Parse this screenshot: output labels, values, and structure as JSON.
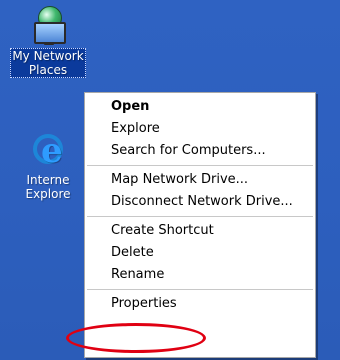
{
  "desktop": {
    "icons": [
      {
        "label_line1": "My Network",
        "label_line2": "Places"
      },
      {
        "label_line1": "Interne",
        "label_line2": "Explore"
      }
    ]
  },
  "context_menu": {
    "items": [
      {
        "label": "Open"
      },
      {
        "label": "Explore"
      },
      {
        "label": "Search for Computers..."
      },
      {
        "label": "Map Network Drive..."
      },
      {
        "label": "Disconnect Network Drive..."
      },
      {
        "label": "Create Shortcut"
      },
      {
        "label": "Delete"
      },
      {
        "label": "Rename"
      },
      {
        "label": "Properties"
      }
    ]
  },
  "annotation": {
    "color": "#e00012"
  },
  "colors": {
    "desktop_blue": "#2f62c2",
    "selection_blue": "#0b3a9c"
  }
}
